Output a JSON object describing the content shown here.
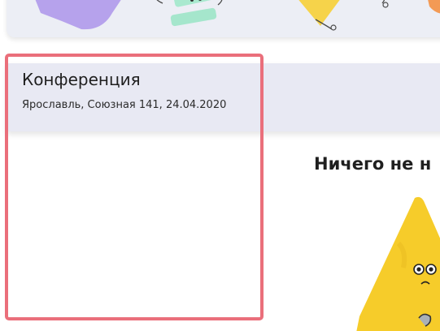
{
  "event": {
    "title": "Конференция",
    "subtitle": "Ярославль, Союзная 141, 24.04.2020"
  },
  "empty_state": {
    "heading": "Ничего не н"
  },
  "colors": {
    "card_background": "#e8e9f3",
    "highlight": "#ea6f7b",
    "illustration_yellow": "#f6cc2a"
  },
  "icons": {
    "top_banner": [
      "purple-shape-icon",
      "green-cards-icon",
      "yellow-triangle-icon",
      "orange-shape-icon"
    ],
    "empty_state": "sad-triangle-mascot-icon"
  }
}
